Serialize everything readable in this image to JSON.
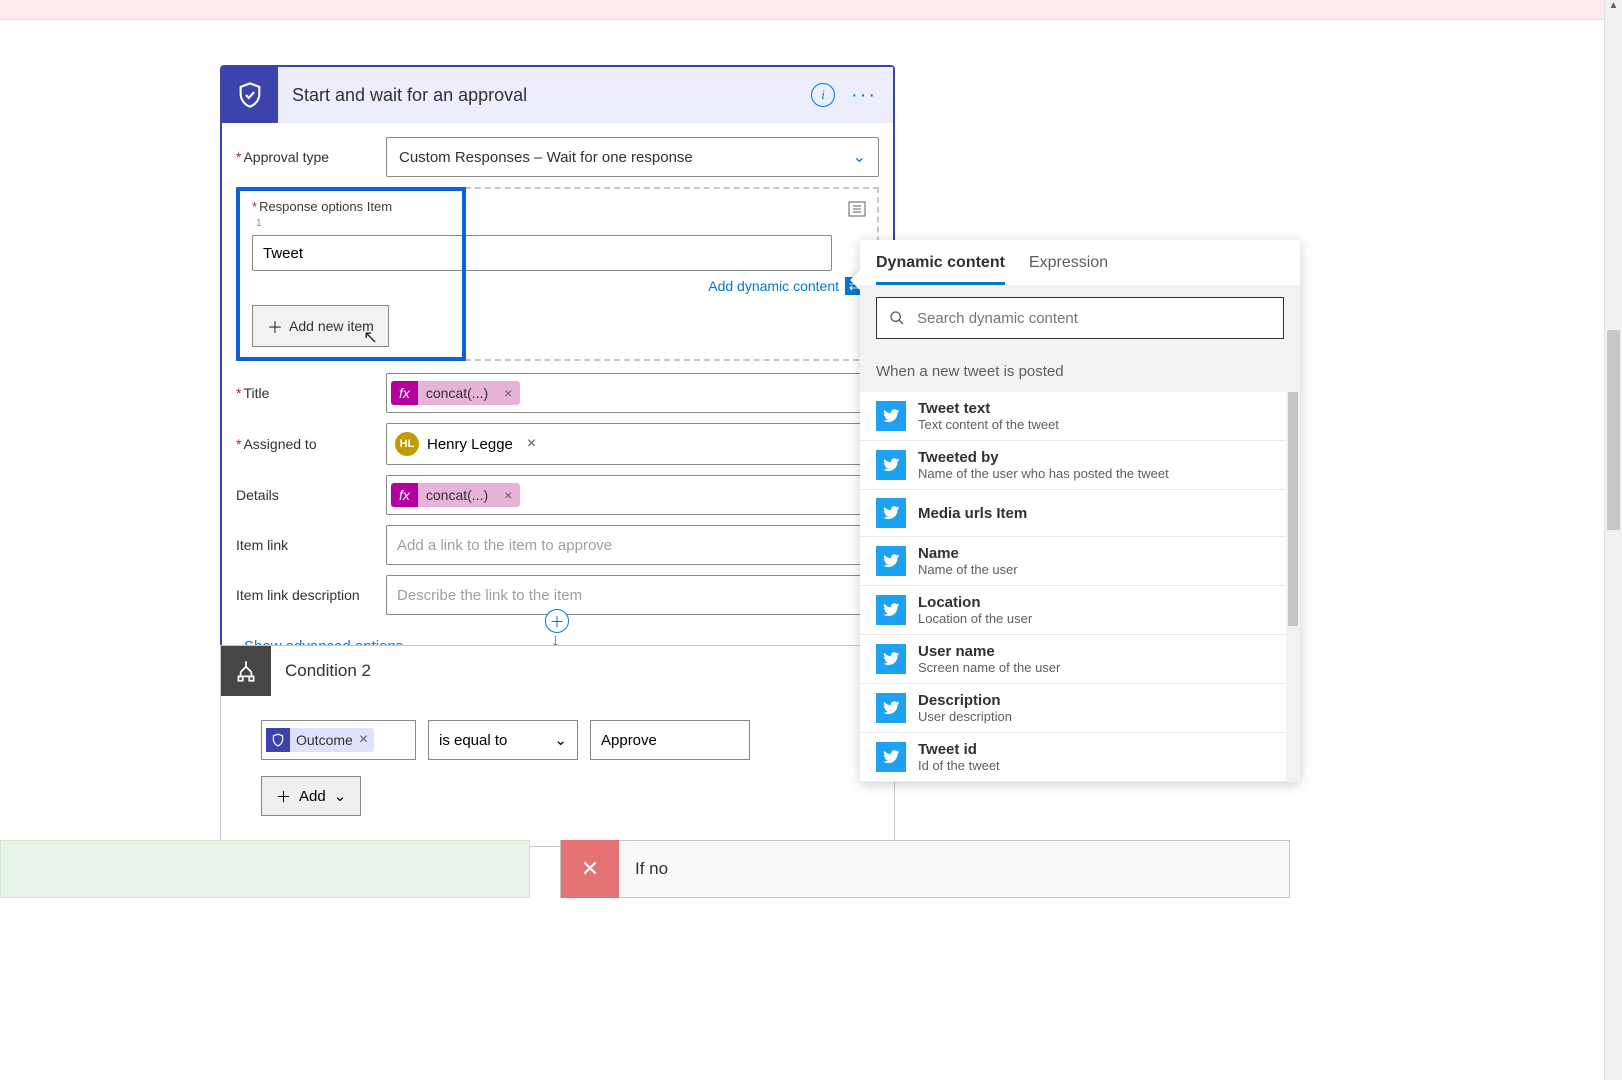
{
  "approval": {
    "title": "Start and wait for an approval",
    "fields": {
      "approval_type": {
        "label": "Approval type",
        "value": "Custom Responses – Wait for one response"
      },
      "response_options": {
        "label": "Response options Item",
        "item_number": "1",
        "value": "Tweet",
        "add_dynamic": "Add dynamic content",
        "add_new": "Add new item"
      },
      "title_field": {
        "label": "Title",
        "token": "concat(...)"
      },
      "assigned_to": {
        "label": "Assigned to",
        "person_initials": "HL",
        "person_name": "Henry Legge"
      },
      "details": {
        "label": "Details",
        "token": "concat(...)"
      },
      "item_link": {
        "label": "Item link",
        "placeholder": "Add a link to the item to approve"
      },
      "item_link_desc": {
        "label": "Item link description",
        "placeholder": "Describe the link to the item"
      }
    },
    "advanced": "Show advanced options"
  },
  "condition": {
    "title": "Condition 2",
    "left_token": "Outcome",
    "operator": "is equal to",
    "value": "Approve",
    "add": "Add"
  },
  "ifno": {
    "label": "If no"
  },
  "dynamic": {
    "tabs": {
      "content": "Dynamic content",
      "expression": "Expression"
    },
    "search_placeholder": "Search dynamic content",
    "section": "When a new tweet is posted",
    "items": [
      {
        "title": "Tweet text",
        "desc": "Text content of the tweet"
      },
      {
        "title": "Tweeted by",
        "desc": "Name of the user who has posted the tweet"
      },
      {
        "title": "Media urls Item",
        "desc": ""
      },
      {
        "title": "Name",
        "desc": "Name of the user"
      },
      {
        "title": "Location",
        "desc": "Location of the user"
      },
      {
        "title": "User name",
        "desc": "Screen name of the user"
      },
      {
        "title": "Description",
        "desc": "User description"
      },
      {
        "title": "Tweet id",
        "desc": "Id of the tweet"
      }
    ]
  }
}
